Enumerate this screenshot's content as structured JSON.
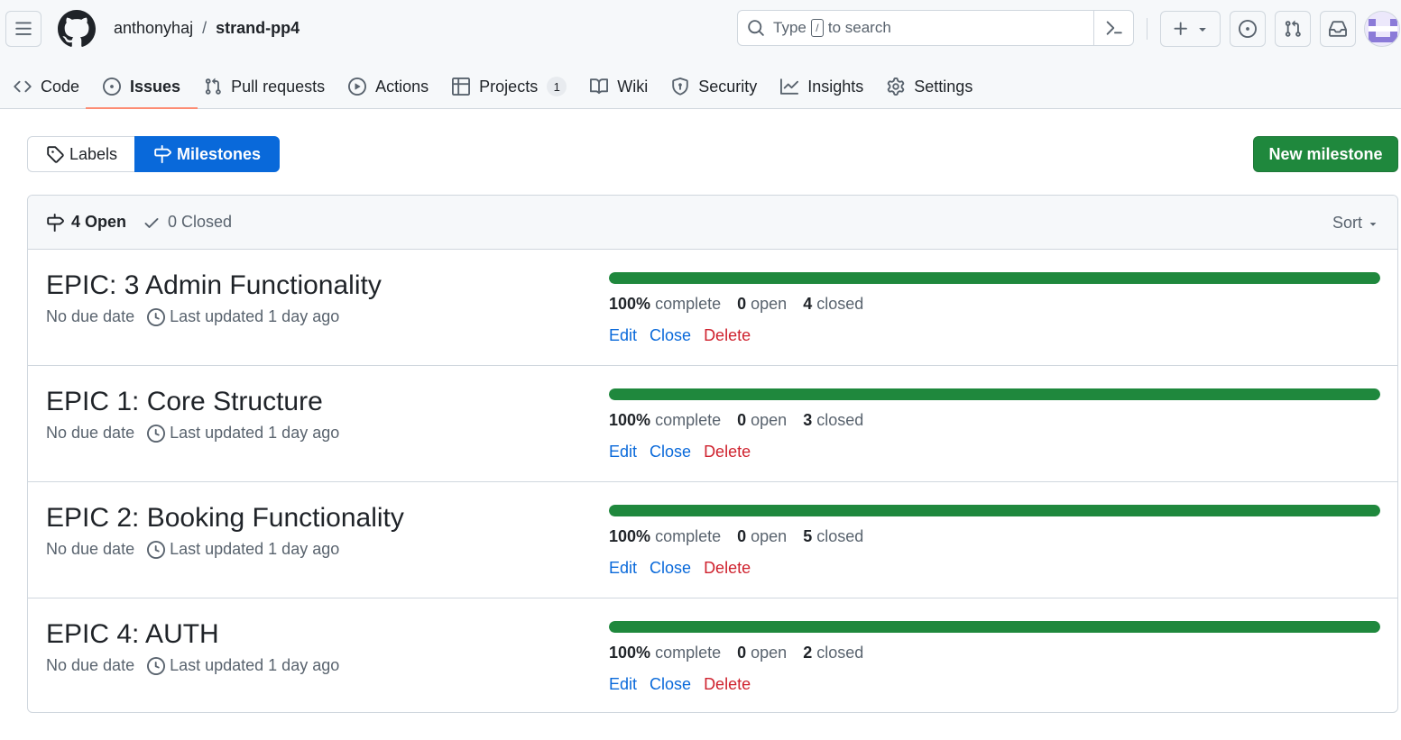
{
  "header": {
    "owner": "anthonyhaj",
    "separator": "/",
    "repo": "strand-pp4",
    "search_placeholder_pre": "Type",
    "search_key": "/",
    "search_placeholder_post": "to search"
  },
  "tabs": [
    {
      "label": "Code",
      "icon": "code-icon"
    },
    {
      "label": "Issues",
      "icon": "issue-opened-icon",
      "active": true
    },
    {
      "label": "Pull requests",
      "icon": "git-pull-request-icon"
    },
    {
      "label": "Actions",
      "icon": "play-icon"
    },
    {
      "label": "Projects",
      "icon": "table-icon",
      "count": "1"
    },
    {
      "label": "Wiki",
      "icon": "book-icon"
    },
    {
      "label": "Security",
      "icon": "shield-icon"
    },
    {
      "label": "Insights",
      "icon": "graph-icon"
    },
    {
      "label": "Settings",
      "icon": "gear-icon"
    }
  ],
  "subnav": {
    "labels": "Labels",
    "milestones": "Milestones",
    "new_milestone": "New milestone"
  },
  "list_header": {
    "open_label": "4 Open",
    "closed_label": "0 Closed",
    "sort": "Sort"
  },
  "milestones": [
    {
      "title": "EPIC: 3 Admin Functionality",
      "due": "No due date",
      "updated": "Last updated 1 day ago",
      "progress": 100,
      "percent": "100%",
      "complete_label": "complete",
      "open_count": "0",
      "open_label": "open",
      "closed_count": "4",
      "closed_label": "closed",
      "edit": "Edit",
      "close": "Close",
      "delete": "Delete"
    },
    {
      "title": "EPIC 1: Core Structure",
      "due": "No due date",
      "updated": "Last updated 1 day ago",
      "progress": 100,
      "percent": "100%",
      "complete_label": "complete",
      "open_count": "0",
      "open_label": "open",
      "closed_count": "3",
      "closed_label": "closed",
      "edit": "Edit",
      "close": "Close",
      "delete": "Delete"
    },
    {
      "title": "EPIC 2: Booking Functionality",
      "due": "No due date",
      "updated": "Last updated 1 day ago",
      "progress": 100,
      "percent": "100%",
      "complete_label": "complete",
      "open_count": "0",
      "open_label": "open",
      "closed_count": "5",
      "closed_label": "closed",
      "edit": "Edit",
      "close": "Close",
      "delete": "Delete"
    },
    {
      "title": "EPIC 4: AUTH",
      "due": "No due date",
      "updated": "Last updated 1 day ago",
      "progress": 100,
      "percent": "100%",
      "complete_label": "complete",
      "open_count": "0",
      "open_label": "open",
      "closed_count": "2",
      "closed_label": "closed",
      "edit": "Edit",
      "close": "Close",
      "delete": "Delete"
    }
  ],
  "colors": {
    "accent": "#0969da",
    "success": "#1f883d",
    "danger": "#cf222e",
    "tab_underline": "#fd8c73"
  }
}
